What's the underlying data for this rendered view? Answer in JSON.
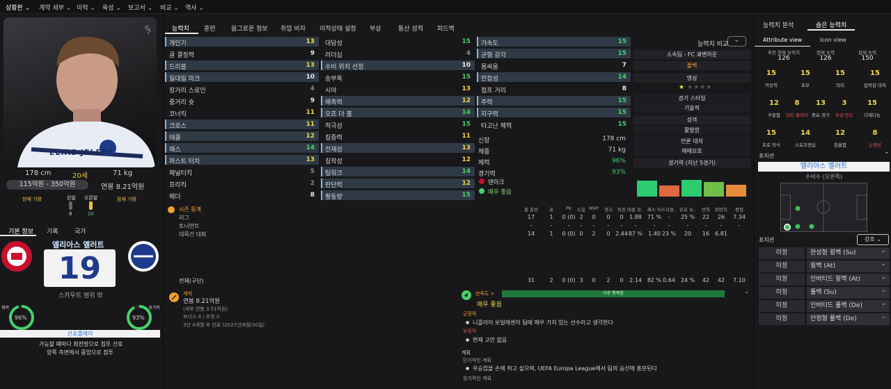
{
  "topnav": [
    {
      "label": "상황판 ⌄",
      "on": true
    },
    {
      "label": "계약 세부 ⌄"
    },
    {
      "label": "이적 ⌄"
    },
    {
      "label": "육성 ⌄"
    },
    {
      "label": "보고서 ⌄"
    },
    {
      "label": "비교 ⌄"
    },
    {
      "label": "역사 ⌄"
    }
  ],
  "player": {
    "badge": "EPL",
    "shirt_name": "ELIAS JELERT",
    "height": "178 cm",
    "age": "20세",
    "weight": "71 kg",
    "value": "115억원 - 350억원",
    "wage": "연봉 8.21억원",
    "current_role_label": "현재 기량",
    "potential_role_label": "잠재 기량",
    "left_foot_label": "왼발",
    "right_foot_label": "오른발",
    "left_foot_val": "8",
    "right_foot_val": "20"
  },
  "left_tabs": [
    "기본 정보",
    "기록",
    "국가"
  ],
  "nation": {
    "name": "엘리아스 옐러트",
    "number": "19",
    "scout_text": "스카우트 범위 밖",
    "fitness_label": "체력",
    "fitness_val": "96%",
    "sharp_label": "경기력",
    "sharp_val": "93%",
    "pref_moves_title": "선호플레이",
    "pref_moves": [
      "가능할 때마다 최전방으로 침투 선호",
      "양쪽 측면에서 중앙으로 침투"
    ]
  },
  "mid_tabs": [
    "능력치",
    "훈련",
    "옵그로운 정보",
    "취업 비자",
    "이적상태 설정",
    "부상",
    "통산 성적",
    "피드백"
  ],
  "attrs_col1": [
    {
      "n": "개인기",
      "v": "13",
      "c": "y",
      "hl": true
    },
    {
      "n": "골 결정력",
      "v": "9",
      "c": "w"
    },
    {
      "n": "드리블",
      "v": "13",
      "c": "y",
      "hl": true
    },
    {
      "n": "일대일 마크",
      "v": "10",
      "c": "w",
      "hl": true
    },
    {
      "n": "장거리 스로인",
      "v": "4",
      "c": "d"
    },
    {
      "n": "중거리 슛",
      "v": "9",
      "c": "w"
    },
    {
      "n": "코너킥",
      "v": "11",
      "c": "y"
    },
    {
      "n": "크로스",
      "v": "11",
      "c": "y",
      "hl": true
    },
    {
      "n": "태클",
      "v": "12",
      "c": "y",
      "hl": true
    },
    {
      "n": "패스",
      "v": "14",
      "c": "g",
      "hl": true
    },
    {
      "n": "퍼스트 터치",
      "v": "13",
      "c": "y",
      "hl": true
    },
    {
      "n": "페널티킥",
      "v": "5",
      "c": "d"
    },
    {
      "n": "프리킥",
      "v": "2",
      "c": "d"
    },
    {
      "n": "헤더",
      "v": "8",
      "c": "w"
    }
  ],
  "attrs_col2": [
    {
      "n": "대담성",
      "v": "15",
      "c": "g"
    },
    {
      "n": "리더십",
      "v": "4",
      "c": "d"
    },
    {
      "n": "수비 위치 선정",
      "v": "10",
      "c": "w",
      "hl": true
    },
    {
      "n": "승부욕",
      "v": "15",
      "c": "g"
    },
    {
      "n": "시야",
      "v": "13",
      "c": "y"
    },
    {
      "n": "예측력",
      "v": "12",
      "c": "y",
      "hl": true
    },
    {
      "n": "오프 더 볼",
      "v": "14",
      "c": "g",
      "hl": true
    },
    {
      "n": "적극성",
      "v": "15",
      "c": "g"
    },
    {
      "n": "집중력",
      "v": "11",
      "c": "y"
    },
    {
      "n": "전재성",
      "v": "13",
      "c": "y",
      "hl": true
    },
    {
      "n": "침착성",
      "v": "12",
      "c": "y"
    },
    {
      "n": "팀워크",
      "v": "14",
      "c": "g",
      "hl": true
    },
    {
      "n": "판단력",
      "v": "12",
      "c": "y",
      "hl": true
    },
    {
      "n": "활동량",
      "v": "15",
      "c": "g",
      "hl": true
    }
  ],
  "attrs_col3": [
    {
      "n": "가속도",
      "v": "15",
      "c": "g",
      "hl": true
    },
    {
      "n": "균형 감각",
      "v": "15",
      "c": "g",
      "hl": true
    },
    {
      "n": "몸싸움",
      "v": "7",
      "c": "w"
    },
    {
      "n": "민첩성",
      "v": "14",
      "c": "g",
      "hl": true
    },
    {
      "n": "점프 거리",
      "v": "8",
      "c": "w"
    },
    {
      "n": "주력",
      "v": "15",
      "c": "g",
      "hl": true
    },
    {
      "n": "지구력",
      "v": "15",
      "c": "g",
      "hl": true
    },
    {
      "n": "타고난 체력",
      "v": "15",
      "c": "g"
    }
  ],
  "phys": [
    {
      "n": "신장",
      "v": "178 cm"
    },
    {
      "n": "체중",
      "v": "71 kg"
    },
    {
      "n": "체력",
      "v": "96%",
      "c": "g"
    },
    {
      "n": "경기력",
      "v": "93%",
      "c": "g"
    }
  ],
  "nation_flag_label": "덴마크",
  "morale_label": "매우 좋음",
  "compare": {
    "button": "능력치 비교",
    "club": "소속팀 - FC 쾨벤하운",
    "role_pos": "풀백",
    "fame_title": "명성",
    "style_title": "경기 스타일",
    "style_val": "기술적",
    "personality_title": "성격",
    "personality_val": "활발함",
    "media_title": "언론 대처",
    "media_val": "애매모호",
    "form_title": "경기력 (지난 5경기)",
    "form": [
      0.9,
      0.6,
      0.92,
      0.8,
      0.66
    ],
    "form_colors": [
      "#2ecc71",
      "#e0683c",
      "#2ecc71",
      "#6fbf4a",
      "#e58b3c"
    ]
  },
  "season": {
    "title": "시즌 통계",
    "cols": [
      "총 출장",
      "골",
      "PK",
      "도움",
      "MVP",
      "경고",
      "퇴장",
      "태클 성..",
      "패스 %",
      "드리블..",
      "유효 슈..",
      "반칙",
      "피반칙",
      "평점"
    ],
    "rows": [
      {
        "label": "리그",
        "vals": [
          "17",
          "1",
          "0 (0)",
          "2",
          "0",
          "0",
          "0",
          "1.88",
          "71 %",
          "-",
          "25 %",
          "22",
          "26",
          "7.34"
        ]
      },
      {
        "label": "토너먼트",
        "vals": [
          "-",
          "-",
          "-",
          "-",
          "-",
          "-",
          "-",
          "-",
          "-",
          "-",
          "-",
          "-",
          "-",
          "-"
        ]
      },
      {
        "label": "대륙간 대회",
        "vals": [
          "14",
          "1",
          "0 (0)",
          "0",
          "2",
          "0",
          "2.44",
          "87 %",
          "1.40",
          "23 %",
          "20",
          "16",
          "6.81"
        ]
      }
    ],
    "total_label": "전체(구단)",
    "total": [
      "31",
      "2",
      "0 (0)",
      "3",
      "0",
      "2",
      "0",
      "2.14",
      "82 %",
      "0.64",
      "24 %",
      "42",
      "42",
      "7.10"
    ]
  },
  "contract": {
    "title": "계약",
    "wage": "연봉 8.21억원",
    "wage_sub": "(세후 연봉 3.51억원)",
    "bonus": "보너스 4 / 조항 0",
    "expire": "3년 4개월 후 만료 (2027년/6월/30일)"
  },
  "morale": {
    "title": "만족도 >",
    "bar": "아주 행복함",
    "status": "매우 좋음",
    "pos_title": "긍정적",
    "pos_item": "니콜라이 보일레센이 팀에 매우 가치 있는 선수라고 생각한다",
    "neg_title": "부정적",
    "neg_item": "현재 고민 없음",
    "plan_title": "계획",
    "short_title": "단기적인 계획",
    "short_item": "우승컵을 손에 쥐고 싶으며, UEFA Europa League에서 팀의 승산에 흥분된다",
    "long_title": "장기적인 계획"
  },
  "right": {
    "tabs": [
      "능력치 분석",
      "숨은 능력치"
    ],
    "views": [
      "Attribute view",
      "Icon view"
    ],
    "head": [
      {
        "l": "추천 현재 능력치",
        "v": "126"
      },
      {
        "l": "현재 능력",
        "v": "126"
      },
      {
        "l": "잠재 능력",
        "v": "150"
      }
    ],
    "hidden": [
      {
        "v": "15",
        "l": "적응력",
        "c": "y"
      },
      {
        "v": "15",
        "l": "포부",
        "c": "y"
      },
      {
        "v": "15",
        "l": "의리",
        "c": "y"
      },
      {
        "v": "15",
        "l": "압박감 대처",
        "c": "y"
      },
      {
        "v": "12",
        "l": "꾸준함",
        "c": "y"
      },
      {
        "v": "8",
        "l": "더티 플레이",
        "c": "w",
        "lc": "#e05454"
      },
      {
        "v": "13",
        "l": "중요 경기",
        "c": "y"
      },
      {
        "v": "3",
        "l": "부상 빈도",
        "c": "d",
        "lc": "#e05454"
      },
      {
        "v": "15",
        "l": "다재다능",
        "c": "y"
      },
      {
        "v": "15",
        "l": "프로 의식",
        "c": "y"
      },
      {
        "v": "14",
        "l": "스포츠맨십",
        "c": "y"
      },
      {
        "v": "12",
        "l": "침울함",
        "c": "y"
      },
      {
        "v": "8",
        "l": "논쟁성",
        "c": "w",
        "lc": "#e05454"
      }
    ],
    "position_title": "포지션",
    "pos_name": "엘리아스 옐러트",
    "pos_sub": "수비수 (오른쪽)",
    "role_title": "포지션",
    "emphasis": "강조",
    "roles": [
      {
        "a": "미정",
        "b": "완성형 윙백 (Su)"
      },
      {
        "a": "미정",
        "b": "윙백 (At)"
      },
      {
        "a": "미정",
        "b": "인버티드 윙백 (At)"
      },
      {
        "a": "미정",
        "b": "풀백 (Su)"
      },
      {
        "a": "미정",
        "b": "인버티드 풀백 (De)"
      },
      {
        "a": "미정",
        "b": "안정형 풀백 (De)"
      }
    ]
  },
  "colors": {
    "accent_green": "#47d16a",
    "accent_yellow": "#f0d84a",
    "highlight_row": "#2f3a46",
    "bad": "#e05454"
  }
}
